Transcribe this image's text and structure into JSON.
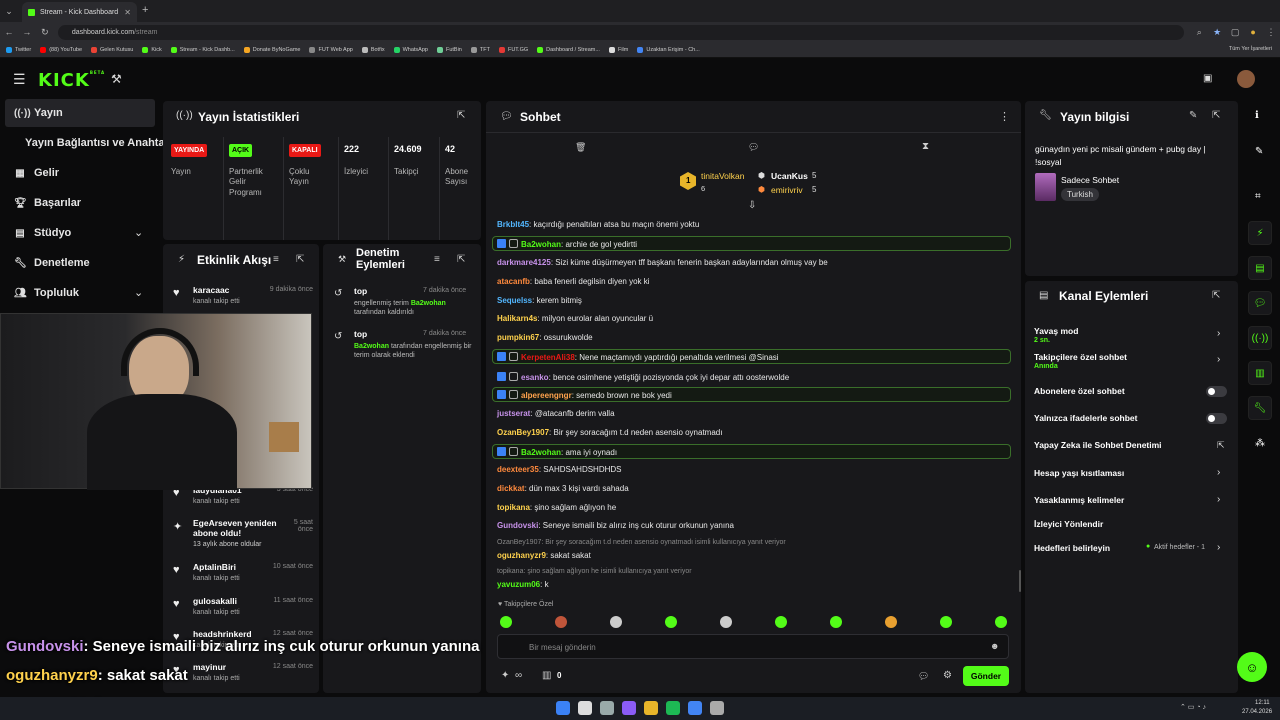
{
  "browser": {
    "tab_title": "Stream - Kick Dashboard",
    "url_host": "dashboard.kick.com",
    "url_path": "/stream",
    "bookmarks": [
      "Twitter",
      "(88) YouTube",
      "Gelen Kutusu",
      "Kick",
      "Stream - Kick Dashb...",
      "Donate ByNoGame",
      "FUT Web App",
      "Botfix",
      "WhatsApp",
      "FutBin",
      "TFT",
      "FUT.GG",
      "Dashboard / Stream...",
      "Film",
      "Uzaktan Erişim - Ch..."
    ],
    "all_bookmarks": "Tüm Yer İşaretleri"
  },
  "brand": {
    "logo": "KICK",
    "beta": "BETA"
  },
  "sidebar": {
    "items": [
      "Yayın",
      "Yayın Bağlantısı ve Anahtarı",
      "Gelir",
      "Başarılar",
      "Stüdyo",
      "Denetleme",
      "Topluluk"
    ]
  },
  "stats": {
    "title": "Yayın İstatistikleri",
    "cols": [
      {
        "badge": "YAYINDA",
        "label": "Yayın"
      },
      {
        "badge": "AÇIK",
        "label": "Partnerlik Gelir Programı"
      },
      {
        "badge": "KAPALI",
        "label": "Çoklu Yayın"
      },
      {
        "num": "222",
        "label": "İzleyici"
      },
      {
        "num": "24.609",
        "label": "Takipçi"
      },
      {
        "num": "42",
        "label": "Abone Sayısı"
      }
    ],
    "colors": {
      "live": "#e91916",
      "on": "#53fc18"
    }
  },
  "activity": {
    "title": "Etkinlik Akışı",
    "items": [
      {
        "name": "karacaac",
        "sub": "kanalı takip etti",
        "time": "9 dakika önce"
      },
      {
        "name": "ladydiana01",
        "sub": "kanalı takip etti",
        "time": "3 saat önce"
      },
      {
        "name": "EgeArseven yeniden abone oldu!",
        "sub": "13 aylık abone oldular",
        "time": "5 saat önce"
      },
      {
        "name": "AptalinBiri",
        "sub": "kanalı takip etti",
        "time": "10 saat önce"
      },
      {
        "name": "gulosakalli",
        "sub": "kanalı takip etti",
        "time": "11 saat önce"
      },
      {
        "name": "headshrinkerd",
        "sub": "kanalı takip etti",
        "time": "12 saat önce"
      },
      {
        "name": "mayinur",
        "sub": "kanalı takip etti",
        "time": "12 saat önce"
      }
    ]
  },
  "moderation": {
    "title": "Denetim Eylemleri",
    "items": [
      {
        "name": "top",
        "time": "7 dakika önce",
        "pre": "engellenmiş terim",
        "who": "Ba2wohan",
        "post": "tarafından kaldırıldı"
      },
      {
        "name": "top",
        "time": "7 dakika önce",
        "pre": "",
        "who": "Ba2wohan",
        "post": "tarafından engellenmiş bir terim olarak eklendi"
      }
    ]
  },
  "chat": {
    "title": "Sohbet",
    "top": {
      "left_user": "tinitaVolkan",
      "left_count": "6",
      "right": [
        {
          "user": "UcanKus",
          "count": "5"
        },
        {
          "user": "emirivriv",
          "count": "5"
        }
      ]
    },
    "messages": [
      {
        "user": "Brkblt45",
        "color": "#53b7ff",
        "text": "kaçırdığı penaltıları atsa bu maçın önemi yoktu"
      },
      {
        "user": "Ba2wohan",
        "color": "#53fc18",
        "text": "archie de gol yedirtti",
        "hl": true
      },
      {
        "user": "darkmare4125",
        "color": "#c792ea",
        "text": "Sizi küme düşürmeyen tff başkanı fenerin başkan adaylarından olmuş vay be"
      },
      {
        "user": "atacanfb",
        "color": "#ff8a3d",
        "text": "baba fenerli degilsin diyen yok ki"
      },
      {
        "user": "Sequelss",
        "color": "#53b7ff",
        "text": "kerem bitmiş"
      },
      {
        "user": "Halikarn4s",
        "color": "#ffd24d",
        "text": "milyon eurolar alan oyuncular ü"
      },
      {
        "user": "pumpkin67",
        "color": "#ffd24d",
        "text": "ossurukwolde"
      },
      {
        "user": "KerpetenAli38",
        "color": "#e91916",
        "text": "Nene maçtamıydı yaptırdığı penaltıda verilmesi @Sinasi",
        "hl": true
      },
      {
        "user": "esanko",
        "color": "#c792ea",
        "text": "bence osimhene yetiştiği pozisyonda çok iyi depar attı oosterwolde"
      },
      {
        "user": "alpereengngr",
        "color": "#ffa34d",
        "text": "semedo brown ne bok yedi",
        "hl": true
      },
      {
        "user": "justserat",
        "color": "#c792ea",
        "text": "@atacanfb derim valla"
      },
      {
        "user": "OzanBey1907",
        "color": "#ffd24d",
        "text": "Bir şey soracağım t.d neden asensio oynatmadı"
      },
      {
        "user": "Ba2wohan",
        "color": "#53fc18",
        "text": "ama iyi oynadı",
        "hl": true
      },
      {
        "user": "deexteer35",
        "color": "#ff8a3d",
        "text": "SAHDSAHDSHDHDS"
      },
      {
        "user": "dickkat",
        "color": "#ff8a3d",
        "text": "dün max 3 kişi vardı sahada"
      },
      {
        "user": "topikana",
        "color": "#ffd24d",
        "text": "şino sağlam ağlıyon he"
      },
      {
        "user": "Gundovski",
        "color": "#c792ea",
        "text": "Seneye ismaili biz alırız inş cuk oturur orkunun yanına"
      },
      {
        "user": "oguzhanyzr9",
        "color": "#ffd24d",
        "text": "sakat sakat",
        "reply": "OzanBey1907: Bir şey soracağım t.d neden asensio oynatmadı isimli kullanıcıya yanıt veriyor"
      },
      {
        "user": "yavuzum06",
        "color": "#53fc18",
        "text": "k",
        "reply": "topikana: şino sağlam ağlıyon he isimli kullanıcıya yanıt veriyor"
      }
    ],
    "followers_only": "Takipçilere Özel",
    "placeholder": "Bir mesaj gönderin",
    "send": "Gönder",
    "points": "0",
    "infinity": "∞"
  },
  "info": {
    "title": "Yayın bilgisi",
    "stream_title": "günaydın yeni pc misali gündem + pubg day | !sosyal",
    "category": "Sadece Sohbet",
    "tag": "Turkish"
  },
  "channel": {
    "title": "Kanal Eylemleri",
    "items": [
      {
        "label": "Yavaş mod",
        "sub": "2 sn.",
        "ctrl": "chev"
      },
      {
        "label": "Takipçilere özel sohbet",
        "sub": "Anında",
        "ctrl": "chev"
      },
      {
        "label": "Abonelere özel sohbet",
        "ctrl": "toggle"
      },
      {
        "label": "Yalnızca ifadelerle sohbet",
        "ctrl": "toggle"
      },
      {
        "label": "Yapay Zeka ile Sohbet Denetimi",
        "ctrl": "ext"
      },
      {
        "label": "Hesap yaşı kısıtlaması",
        "ctrl": "chev"
      },
      {
        "label": "Yasaklanmış kelimeler",
        "ctrl": "chev"
      },
      {
        "label": "İzleyici Yönlendir",
        "ctrl": ""
      },
      {
        "label": "Hedefleri belirleyin",
        "ctrl": "chev",
        "extra": "Aktif hedefler - 1"
      }
    ]
  },
  "overlay": [
    {
      "user": "Gundovski",
      "color": "#c792ea",
      "text": ": Seneye ismaili biz alırız inş cuk oturur orkunun yanına"
    },
    {
      "user": "oguzhanyzr9",
      "color": "#ffd24d",
      "text": ": sakat sakat"
    },
    {
      "user": "yavuzum06",
      "color": "#53fc18",
      "text": ": k"
    }
  ],
  "clock": {
    "time": "12:11",
    "date": "27.04.2026"
  }
}
